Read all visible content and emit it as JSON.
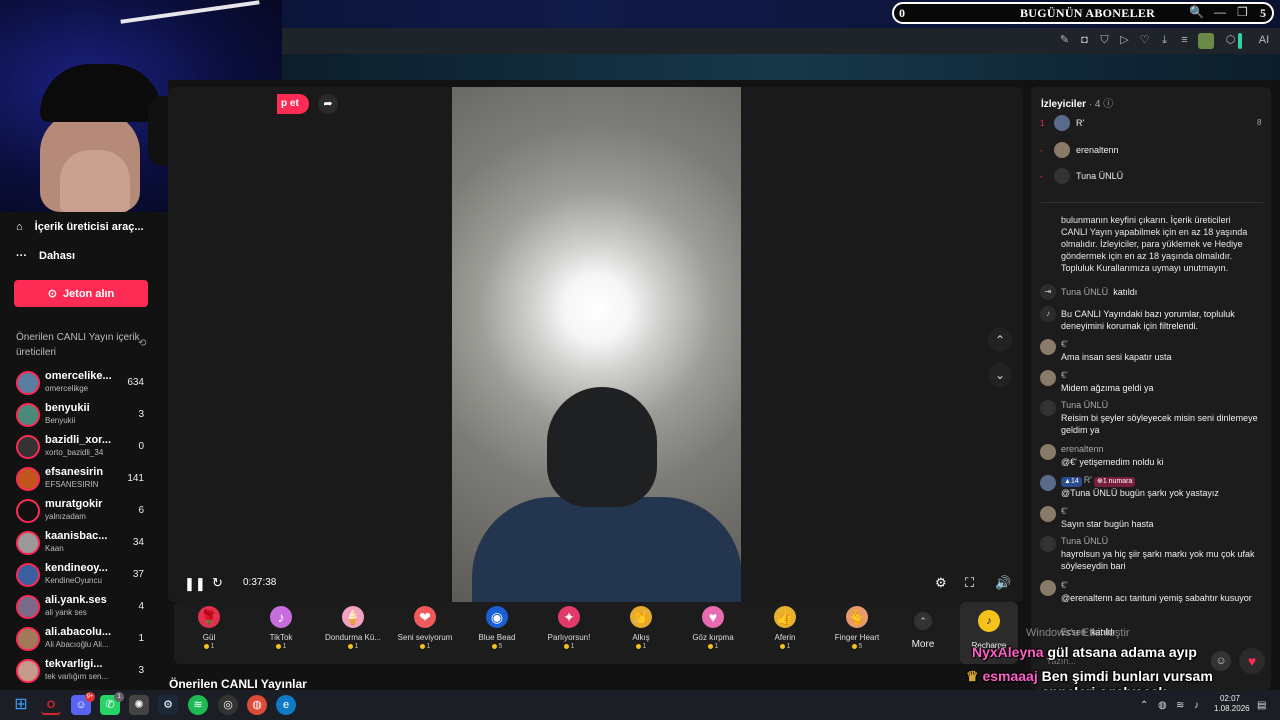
{
  "window": {
    "title_left": "0",
    "title": "BUGÜNÜN ABONELER",
    "title_right": "5",
    "controls": [
      "🔍",
      "—",
      "❐",
      "✕"
    ]
  },
  "toolbar_icons": [
    "edit-icon",
    "camera-icon",
    "shield-icon",
    "play-icon",
    "heart-icon",
    "download-icon",
    "menu-icon",
    "avatar",
    "sidebar-icon",
    "extension-icon",
    "ai-icon"
  ],
  "toolbar_ai_label": "AI",
  "sidebar": {
    "nav": [
      {
        "icon": "creator-tools-icon",
        "label": "İçerik üreticisi araç..."
      },
      {
        "icon": "more-icon",
        "label": "Dahası"
      }
    ],
    "coin_button": "Jeton alın",
    "suggested_title": "Önerilen CANLI Yayın içerik üreticileri",
    "creators": [
      {
        "name": "omercelike...",
        "handle": "omercelikge",
        "count": "634"
      },
      {
        "name": "benyukii",
        "handle": "Benyukii",
        "count": "3"
      },
      {
        "name": "bazidli_xor...",
        "handle": "xorto_bazidli_34",
        "count": "0"
      },
      {
        "name": "efsanesirin",
        "handle": "EFSANESIRIN",
        "count": "141"
      },
      {
        "name": "muratgokir",
        "handle": "yalnızadam",
        "count": "6"
      },
      {
        "name": "kaanisbac...",
        "handle": "Kaan",
        "count": "34"
      },
      {
        "name": "kendineoy...",
        "handle": "KendineOyuncu",
        "count": "37"
      },
      {
        "name": "ali.yank.ses",
        "handle": "ali yank ses",
        "count": "4"
      },
      {
        "name": "ali.abacolu...",
        "handle": "Ali Abacıoğlu Ali...",
        "count": "1"
      },
      {
        "name": "tekvarligi...",
        "handle": "tek varlığım sen...",
        "count": "3"
      }
    ]
  },
  "stream": {
    "follow_label": "p et",
    "time": "0:37:38",
    "section_title": "Önerilen CANLI Yayınlar"
  },
  "gifts": [
    {
      "label": "Gül",
      "price": "1",
      "glyph": "🌹",
      "color": "#e0314f"
    },
    {
      "label": "TikTok",
      "price": "1",
      "glyph": "♪",
      "color": "#c86de0"
    },
    {
      "label": "Dondurma Kü...",
      "price": "1",
      "glyph": "🍦",
      "color": "#f2a2c0"
    },
    {
      "label": "Seni seviyorum",
      "price": "1",
      "glyph": "❤",
      "color": "#f05a5a"
    },
    {
      "label": "Blue Bead",
      "price": "5",
      "glyph": "◉",
      "color": "#1a5fd6"
    },
    {
      "label": "Parlıyorsun!",
      "price": "1",
      "glyph": "✦",
      "color": "#e23a6a"
    },
    {
      "label": "Alkış",
      "price": "1",
      "glyph": "👏",
      "color": "#e8a92c"
    },
    {
      "label": "Göz kırpma",
      "price": "1",
      "glyph": "♥",
      "color": "#e86ab0"
    },
    {
      "label": "Aferin",
      "price": "1",
      "glyph": "👍",
      "color": "#e8b02c"
    },
    {
      "label": "Finger Heart",
      "price": "5",
      "glyph": "🫰",
      "color": "#e89a6a"
    }
  ],
  "more_label": "More",
  "recharge_label": "Recharge",
  "viewers": {
    "title": "İzleyiciler",
    "count": "· 4",
    "list": [
      {
        "rank": "1",
        "name": "R'",
        "score": "8"
      },
      {
        "rank": "-",
        "name": "erenaltenn",
        "score": ""
      },
      {
        "rank": "-",
        "name": "Tuna ÜNLÜ",
        "score": ""
      }
    ]
  },
  "chat": {
    "notice": "bulunmanın keyfini çıkarın. İçerik üreticileri CANLI Yayın yapabilmek için en az 18 yaşında olmalıdır. İzleyiciler, para yüklemek ve Hediye göndermek için en az 18 yaşında olmalıdır. Topluluk Kurallarımıza uymayı unutmayın.",
    "joined_user": "Tuna ÜNLÜ",
    "joined_text": "katıldı",
    "filter_notice": "Bu CANLI Yayındaki bazı yorumlar, topluluk deneyimini korumak için filtrelendi.",
    "messages": [
      {
        "user": "€'",
        "text": "Ama insan sesi kapatır usta"
      },
      {
        "user": "€'",
        "text": "Midem ağzıma geldi ya"
      },
      {
        "user": "Tuna ÜNLÜ",
        "text": "Reisim bi şeyler söyleyecek misin seni dinlemeye geldim ya"
      },
      {
        "user": "erenaltenn",
        "text": "@€' yetişemedim noldu ki"
      },
      {
        "user": "R'",
        "text": "@Tuna ÜNLÜ bugün şarkı yok yastayız",
        "level": "14",
        "badge": "1 numara"
      },
      {
        "user": "€'",
        "text": "Sayın star bugün hasta"
      },
      {
        "user": "Tuna ÜNLÜ",
        "text": "hayrolsun ya hiç şiir şarkı markı yok mu çok ufak söyleseydin bari"
      },
      {
        "user": "€'",
        "text": "@erenaltenn acı tantuni yemiş sabahtır kusuyor"
      }
    ],
    "last_joined": "Ecsen",
    "input_placeholder": "Yazın..."
  },
  "watermark": "Windows'u Etkinleştir",
  "overlay_chat": [
    {
      "user": "NyxAleyna",
      "text": "gül atsana adama ayıp"
    },
    {
      "user": "esmaaaj",
      "text": "Ben şimdi bunları vursam anneleri agalyacak"
    }
  ],
  "taskbar": {
    "apps": [
      {
        "icon": "windows-icon",
        "glyph": "⊞",
        "color": "#1e90ff"
      },
      {
        "icon": "opera-icon",
        "glyph": "O",
        "color": "#d8232a"
      },
      {
        "icon": "discord-icon",
        "glyph": "☺",
        "color": "#5865f2",
        "badge": "9+"
      },
      {
        "icon": "whatsapp-icon",
        "glyph": "✆",
        "color": "#25d366",
        "badge": "1"
      },
      {
        "icon": "chatgpt-icon",
        "glyph": "✺",
        "color": "#444"
      },
      {
        "icon": "steam-icon",
        "glyph": "⚙",
        "color": "#1b2838"
      },
      {
        "icon": "spotify-icon",
        "glyph": "≋",
        "color": "#1db954"
      },
      {
        "icon": "obs-icon",
        "glyph": "◎",
        "color": "#333"
      },
      {
        "icon": "chrome-icon",
        "glyph": "◍",
        "color": "#dd4b39"
      },
      {
        "icon": "edge-icon",
        "glyph": "e",
        "color": "#0f7ac6"
      }
    ],
    "time": "02:07",
    "date": "1.08.2026"
  }
}
